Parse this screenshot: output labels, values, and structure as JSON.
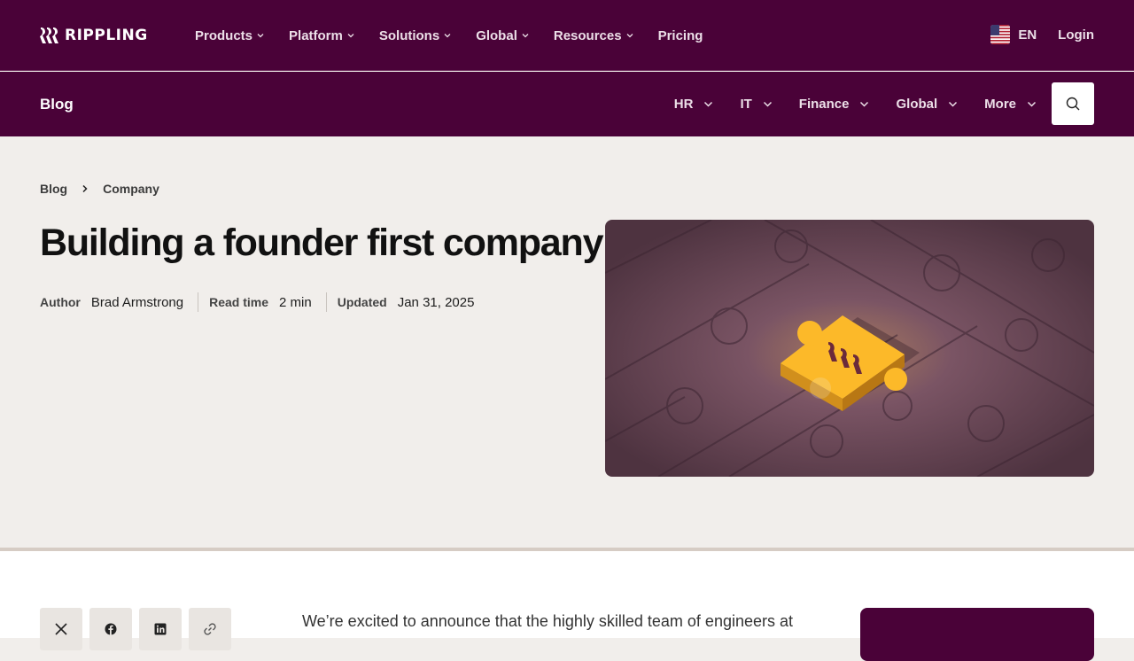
{
  "brand": {
    "name": "RIPPLING"
  },
  "topnav": {
    "items": [
      {
        "label": "Products",
        "has_menu": true
      },
      {
        "label": "Platform",
        "has_menu": true
      },
      {
        "label": "Solutions",
        "has_menu": true
      },
      {
        "label": "Global",
        "has_menu": true
      },
      {
        "label": "Resources",
        "has_menu": true
      },
      {
        "label": "Pricing",
        "has_menu": false
      }
    ],
    "language": "EN",
    "login": "Login"
  },
  "subnav": {
    "title": "Blog",
    "items": [
      {
        "label": "HR"
      },
      {
        "label": "IT"
      },
      {
        "label": "Finance"
      },
      {
        "label": "Global"
      },
      {
        "label": "More"
      }
    ]
  },
  "breadcrumb": [
    "Blog",
    "Company"
  ],
  "post": {
    "title": "Building a founder first company",
    "author_label": "Author",
    "author": "Brad Armstrong",
    "readtime_label": "Read time",
    "readtime": "2 min",
    "updated_label": "Updated",
    "updated": "Jan 31, 2025"
  },
  "article": {
    "first_line": "We’re excited to announce that the highly skilled team of engineers at"
  },
  "colors": {
    "brand": "#4a0238",
    "accent": "#fcb929",
    "background": "#f1eeeb"
  }
}
